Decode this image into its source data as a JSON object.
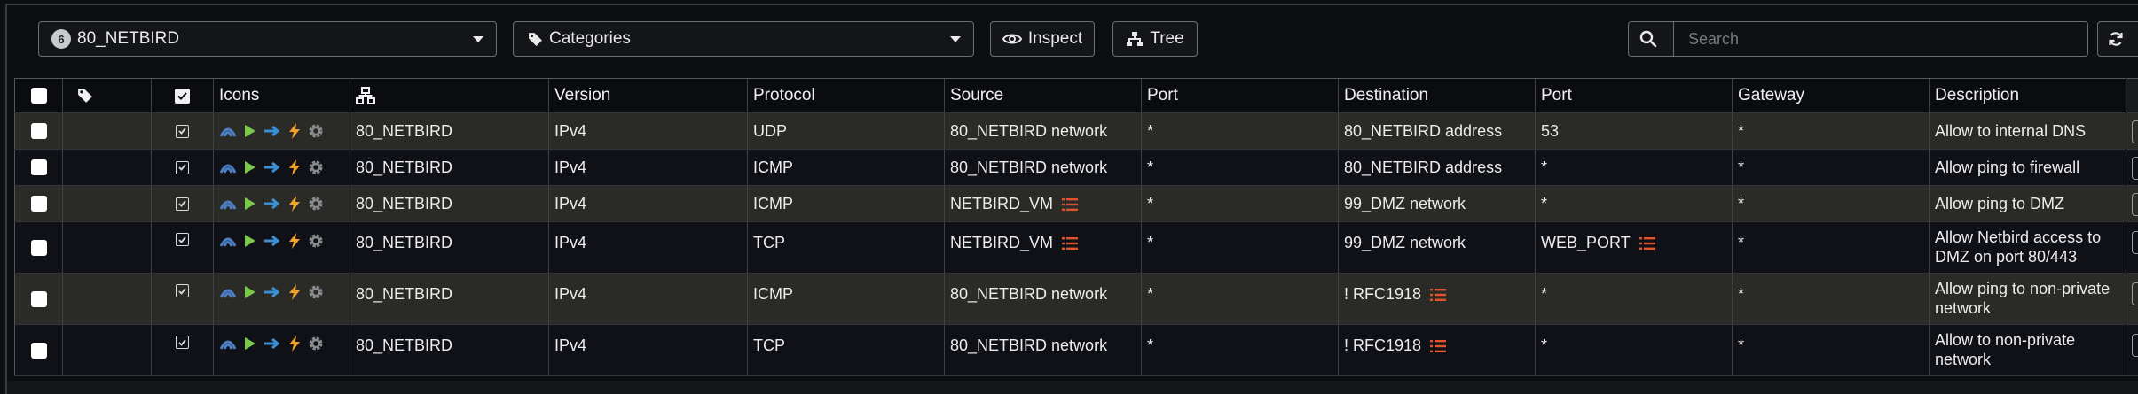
{
  "toolbar": {
    "interface_badge": "6",
    "interface_value": "80_NETBIRD",
    "categories_value": "Categories",
    "inspect_label": "Inspect",
    "tree_label": "Tree",
    "search_placeholder": "Search"
  },
  "columns": {
    "icons": "Icons",
    "version": "Version",
    "protocol": "Protocol",
    "source": "Source",
    "source_port": "Port",
    "destination": "Destination",
    "dest_port": "Port",
    "gateway": "Gateway",
    "description": "Description"
  },
  "rules": [
    {
      "interface": "80_NETBIRD",
      "version": "IPv4",
      "protocol": "UDP",
      "source": "80_NETBIRD network",
      "source_port": "*",
      "destination": "80_NETBIRD address",
      "dest_port": "53",
      "gateway": "*",
      "description": "Allow to internal DNS"
    },
    {
      "interface": "80_NETBIRD",
      "version": "IPv4",
      "protocol": "ICMP",
      "source": "80_NETBIRD network",
      "source_port": "*",
      "destination": "80_NETBIRD address",
      "dest_port": "*",
      "gateway": "*",
      "description": "Allow ping to firewall"
    },
    {
      "interface": "80_NETBIRD",
      "version": "IPv4",
      "protocol": "ICMP",
      "source": "NETBIRD_VM",
      "source_port": "*",
      "destination": "99_DMZ network",
      "dest_port": "*",
      "gateway": "*",
      "description": "Allow ping to DMZ"
    },
    {
      "interface": "80_NETBIRD",
      "version": "IPv4",
      "protocol": "TCP",
      "source": "NETBIRD_VM",
      "source_port": "*",
      "destination": "99_DMZ network",
      "dest_port": "WEB_PORT",
      "gateway": "*",
      "description": "Allow Netbird access to DMZ on port 80/443"
    },
    {
      "interface": "80_NETBIRD",
      "version": "IPv4",
      "protocol": "ICMP",
      "source": "80_NETBIRD network",
      "source_port": "*",
      "destination": "! RFC1918",
      "dest_port": "*",
      "gateway": "*",
      "description": "Allow ping to non-private network"
    },
    {
      "interface": "80_NETBIRD",
      "version": "IPv4",
      "protocol": "TCP",
      "source": "80_NETBIRD network",
      "source_port": "*",
      "destination": "! RFC1918",
      "dest_port": "*",
      "gateway": "*",
      "description": "Allow to non-private network"
    }
  ],
  "icon_names": [
    "direction-in-icon",
    "play-icon",
    "arrow-right-icon",
    "bolt-icon",
    "gear-icon",
    "alias-list-icon",
    "tag-icon",
    "network-icon",
    "refresh-icon",
    "eye-icon",
    "sitemap-icon",
    "search-icon"
  ],
  "colors": {
    "play": "#7cc94a",
    "arrow": "#3b8fd6",
    "bolt": "#f0a32a",
    "gear": "#8a8b8f",
    "list": "#e0532b",
    "dir": "#4d7fc4"
  }
}
